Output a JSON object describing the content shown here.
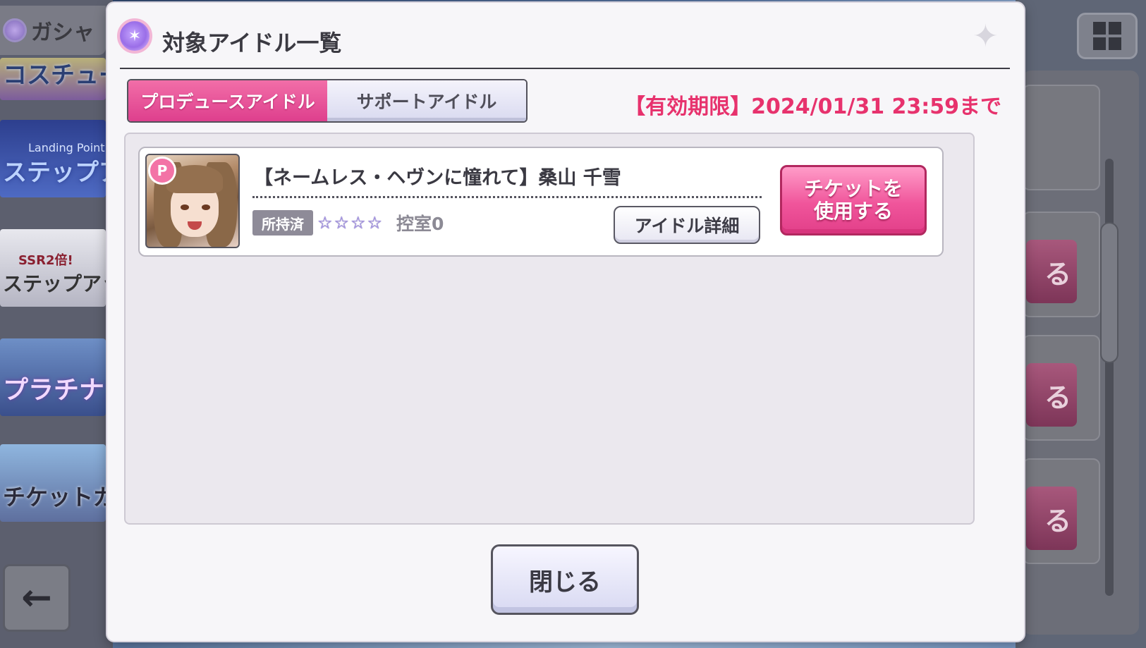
{
  "background": {
    "header_label": "ガシャ",
    "banners": [
      {
        "text": "コスチューム"
      },
      {
        "small": "Landing Point",
        "text": "ステップアップ"
      },
      {
        "small": "SSR2倍!",
        "text": "ステップアップ"
      },
      {
        "text": "プラチナガシャ"
      },
      {
        "text": "チケットガシャ"
      }
    ],
    "right_buttons": [
      "る",
      "る",
      "る"
    ]
  },
  "modal": {
    "title": "対象アイドル一覧",
    "tabs": [
      {
        "label": "プロデュースアイドル",
        "active": true
      },
      {
        "label": "サポートアイドル",
        "active": false
      }
    ],
    "expiry_text": "【有効期限】2024/01/31 23:59まで",
    "idol": {
      "card_name": "【ネームレス・ヘヴンに憧れて】桑山 千雪",
      "type_badge": "P",
      "owned_label": "所持済",
      "stars": [
        "☆",
        "☆",
        "☆",
        "☆"
      ],
      "waiting_text": "控室0",
      "detail_button": "アイドル詳細",
      "use_ticket_button": "チケットを使用する"
    },
    "close_button": "閉じる"
  },
  "colors": {
    "accent_pink": "#e23f89",
    "expiry_red": "#e7326d"
  }
}
